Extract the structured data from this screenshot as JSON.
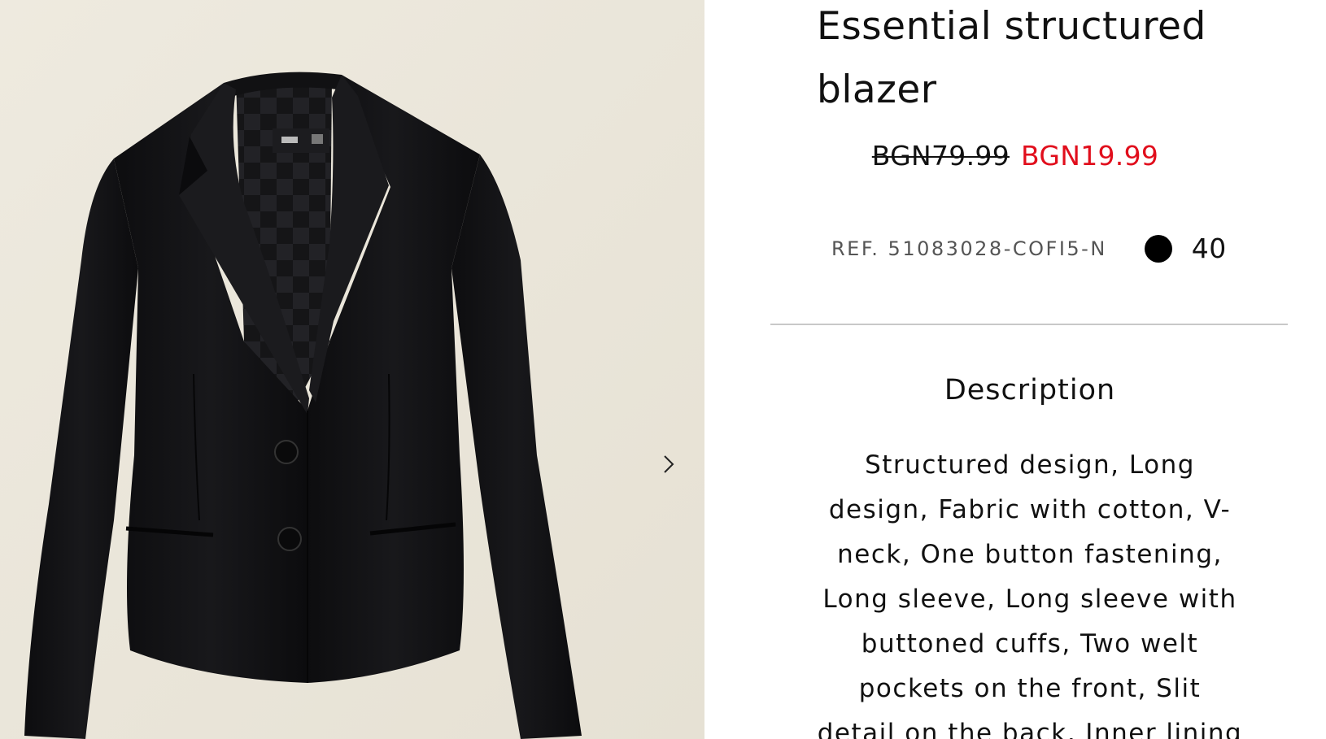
{
  "product": {
    "title": "Essential structured blazer",
    "price_original": "BGN79.99",
    "price_sale": "BGN19.99",
    "reference": "REF. 51083028-COFI5-N",
    "color_swatch": "#000000",
    "size": "40"
  },
  "gallery": {
    "image_alt": "black blazer",
    "background_color": "#ece8dd",
    "next_icon": "chevron-right-icon"
  },
  "description": {
    "heading": "Description",
    "text": "Structured design, Long design, Fabric with cotton, V-neck, One button fastening, Long sleeve, Long sleeve with buttoned cuffs, Two welt pockets on the front, Slit detail on the back, Inner lining"
  },
  "colors": {
    "sale_price": "#e10e1c",
    "divider": "#c8c8c8"
  }
}
